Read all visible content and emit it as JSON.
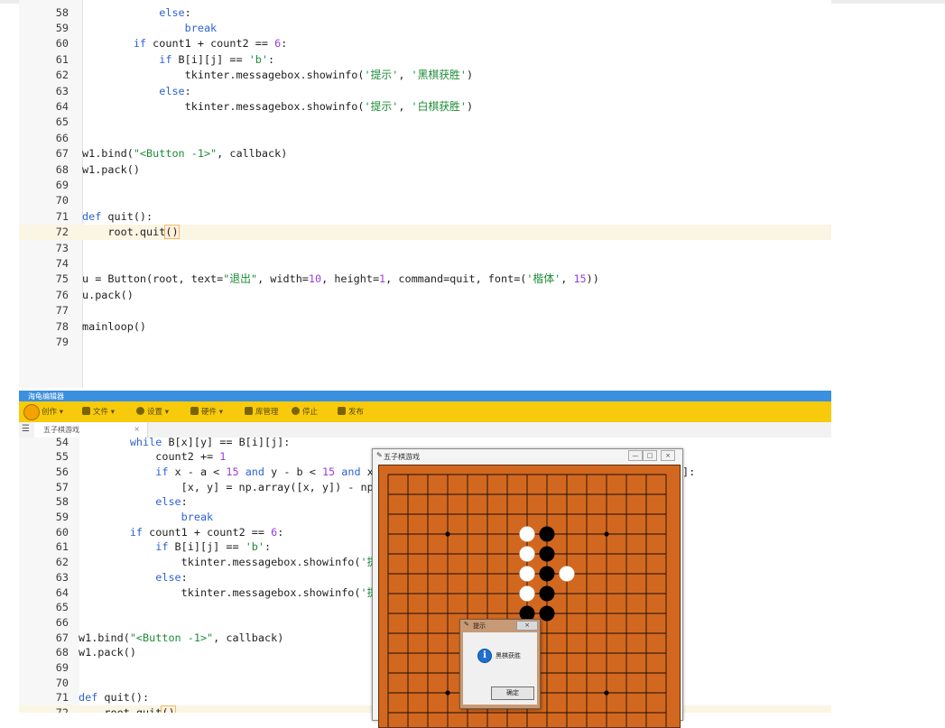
{
  "editor_top": {
    "lines": [
      {
        "n": "58",
        "indent": 6,
        "tokens": [
          {
            "t": "else",
            "c": "kw"
          },
          {
            "t": ":",
            "c": ""
          }
        ]
      },
      {
        "n": "59",
        "indent": 8,
        "tokens": [
          {
            "t": "break",
            "c": "kw"
          }
        ]
      },
      {
        "n": "60",
        "indent": 4,
        "tokens": [
          {
            "t": "if",
            "c": "kw"
          },
          {
            "t": " count1 + count2 == ",
            "c": ""
          },
          {
            "t": "6",
            "c": "num"
          },
          {
            "t": ":",
            "c": ""
          }
        ]
      },
      {
        "n": "61",
        "indent": 6,
        "tokens": [
          {
            "t": "if",
            "c": "kw"
          },
          {
            "t": " B[i][j] == ",
            "c": ""
          },
          {
            "t": "'b'",
            "c": "str"
          },
          {
            "t": ":",
            "c": ""
          }
        ]
      },
      {
        "n": "62",
        "indent": 8,
        "tokens": [
          {
            "t": "tkinter.messagebox.showinfo(",
            "c": ""
          },
          {
            "t": "'提示'",
            "c": "str"
          },
          {
            "t": ", ",
            "c": ""
          },
          {
            "t": "'黑棋获胜'",
            "c": "str"
          },
          {
            "t": ")",
            "c": ""
          }
        ]
      },
      {
        "n": "63",
        "indent": 6,
        "tokens": [
          {
            "t": "else",
            "c": "kw"
          },
          {
            "t": ":",
            "c": ""
          }
        ]
      },
      {
        "n": "64",
        "indent": 8,
        "tokens": [
          {
            "t": "tkinter.messagebox.showinfo(",
            "c": ""
          },
          {
            "t": "'提示'",
            "c": "str"
          },
          {
            "t": ", ",
            "c": ""
          },
          {
            "t": "'白棋获胜'",
            "c": "str"
          },
          {
            "t": ")",
            "c": ""
          }
        ]
      },
      {
        "n": "65",
        "indent": 0,
        "tokens": []
      },
      {
        "n": "66",
        "indent": 0,
        "tokens": []
      },
      {
        "n": "67",
        "indent": 0,
        "tokens": [
          {
            "t": "w1.bind(",
            "c": ""
          },
          {
            "t": "\"<Button -1>\"",
            "c": "str"
          },
          {
            "t": ", callback)",
            "c": ""
          }
        ]
      },
      {
        "n": "68",
        "indent": 0,
        "tokens": [
          {
            "t": "w1.pack()",
            "c": ""
          }
        ]
      },
      {
        "n": "69",
        "indent": 0,
        "tokens": []
      },
      {
        "n": "70",
        "indent": 0,
        "tokens": []
      },
      {
        "n": "71",
        "indent": 0,
        "tokens": [
          {
            "t": "def",
            "c": "kw"
          },
          {
            "t": " quit():",
            "c": ""
          }
        ]
      },
      {
        "n": "72",
        "indent": 2,
        "cur": true,
        "tokens": [
          {
            "t": "root.quit",
            "c": ""
          },
          {
            "t": "()",
            "c": "hl"
          }
        ]
      },
      {
        "n": "73",
        "indent": 0,
        "tokens": []
      },
      {
        "n": "74",
        "indent": 0,
        "tokens": []
      },
      {
        "n": "75",
        "indent": 0,
        "tokens": [
          {
            "t": "u = Button(root, text=",
            "c": ""
          },
          {
            "t": "\"退出\"",
            "c": "str"
          },
          {
            "t": ", width=",
            "c": ""
          },
          {
            "t": "10",
            "c": "num"
          },
          {
            "t": ", height=",
            "c": ""
          },
          {
            "t": "1",
            "c": "num"
          },
          {
            "t": ", command=quit, font=(",
            "c": ""
          },
          {
            "t": "'楷体'",
            "c": "str"
          },
          {
            "t": ", ",
            "c": ""
          },
          {
            "t": "15",
            "c": "num"
          },
          {
            "t": "))",
            "c": ""
          }
        ]
      },
      {
        "n": "76",
        "indent": 0,
        "tokens": [
          {
            "t": "u.pack()",
            "c": ""
          }
        ]
      },
      {
        "n": "77",
        "indent": 0,
        "tokens": []
      },
      {
        "n": "78",
        "indent": 0,
        "tokens": [
          {
            "t": "mainloop()",
            "c": ""
          }
        ]
      },
      {
        "n": "79",
        "indent": 0,
        "tokens": []
      }
    ]
  },
  "ide": {
    "window_title": "海龟编辑器",
    "toolbar": {
      "create": "创作",
      "file": "文件",
      "settings": "设置",
      "hardware": "硬件",
      "library": "库管理",
      "stop": "停止",
      "publish": "发布"
    },
    "tab_label": "五子棋游戏",
    "tab_close": "×"
  },
  "editor_bottom": {
    "lines": [
      {
        "n": "54",
        "indent": 4,
        "tokens": [
          {
            "t": "while",
            "c": "kw"
          },
          {
            "t": " B[x][y] == B[i][j]:",
            "c": ""
          }
        ]
      },
      {
        "n": "55",
        "indent": 6,
        "tokens": [
          {
            "t": "count2 += ",
            "c": ""
          },
          {
            "t": "1",
            "c": "num"
          }
        ]
      },
      {
        "n": "56",
        "indent": 6,
        "tokens": [
          {
            "t": "if",
            "c": "kw"
          },
          {
            "t": " x - a < ",
            "c": ""
          },
          {
            "t": "15",
            "c": "num"
          },
          {
            "t": " ",
            "c": ""
          },
          {
            "t": "and",
            "c": "kw"
          },
          {
            "t": " y - b < ",
            "c": ""
          },
          {
            "t": "15",
            "c": "num"
          },
          {
            "t": " ",
            "c": ""
          },
          {
            "t": "and",
            "c": "kw"
          },
          {
            "t": " x -",
            "c": ""
          }
        ]
      },
      {
        "n": "57",
        "indent": 8,
        "tokens": [
          {
            "t": "[x, y] = np.array([x, y]) - np.ar",
            "c": ""
          }
        ]
      },
      {
        "n": "58",
        "indent": 6,
        "tokens": [
          {
            "t": "else",
            "c": "kw"
          },
          {
            "t": ":",
            "c": ""
          }
        ]
      },
      {
        "n": "59",
        "indent": 8,
        "tokens": [
          {
            "t": "break",
            "c": "kw"
          }
        ]
      },
      {
        "n": "60",
        "indent": 4,
        "tokens": [
          {
            "t": "if",
            "c": "kw"
          },
          {
            "t": " count1 + count2 == ",
            "c": ""
          },
          {
            "t": "6",
            "c": "num"
          },
          {
            "t": ":",
            "c": ""
          }
        ]
      },
      {
        "n": "61",
        "indent": 6,
        "tokens": [
          {
            "t": "if",
            "c": "kw"
          },
          {
            "t": " B[i][j] == ",
            "c": ""
          },
          {
            "t": "'b'",
            "c": "str"
          },
          {
            "t": ":",
            "c": ""
          }
        ]
      },
      {
        "n": "62",
        "indent": 8,
        "tokens": [
          {
            "t": "tkinter.messagebox.showinfo(",
            "c": ""
          },
          {
            "t": "'提示",
            "c": "str"
          }
        ]
      },
      {
        "n": "63",
        "indent": 6,
        "tokens": [
          {
            "t": "else",
            "c": "kw"
          },
          {
            "t": ":",
            "c": ""
          }
        ]
      },
      {
        "n": "64",
        "indent": 8,
        "tokens": [
          {
            "t": "tkinter.messagebox.showinfo(",
            "c": ""
          },
          {
            "t": "'提示",
            "c": "str"
          }
        ]
      },
      {
        "n": "65",
        "indent": 0,
        "tokens": []
      },
      {
        "n": "66",
        "indent": 0,
        "tokens": []
      },
      {
        "n": "67",
        "indent": 0,
        "tokens": [
          {
            "t": "w1.bind(",
            "c": ""
          },
          {
            "t": "\"<Button -1>\"",
            "c": "str"
          },
          {
            "t": ", callback)",
            "c": ""
          }
        ]
      },
      {
        "n": "68",
        "indent": 0,
        "tokens": [
          {
            "t": "w1.pack()",
            "c": ""
          }
        ]
      },
      {
        "n": "69",
        "indent": 0,
        "tokens": []
      },
      {
        "n": "70",
        "indent": 0,
        "tokens": []
      },
      {
        "n": "71",
        "indent": 0,
        "tokens": [
          {
            "t": "def",
            "c": "kw"
          },
          {
            "t": " quit():",
            "c": ""
          }
        ]
      },
      {
        "n": "72",
        "indent": 2,
        "cur": true,
        "tokens": [
          {
            "t": "root.quit",
            "c": ""
          },
          {
            "t": "()",
            "c": "hl"
          }
        ]
      }
    ],
    "right_fragment": "]:"
  },
  "game_window": {
    "title": "五子棋游戏",
    "minimize": "—",
    "maximize": "□",
    "close": "×",
    "board_color": "#d2681f",
    "black_stones": [
      [
        8,
        3
      ],
      [
        8,
        4
      ],
      [
        8,
        5
      ],
      [
        8,
        6
      ],
      [
        7,
        7
      ],
      [
        8,
        7
      ]
    ],
    "white_stones": [
      [
        7,
        3
      ],
      [
        7,
        4
      ],
      [
        7,
        5
      ],
      [
        7,
        6
      ],
      [
        9,
        5
      ]
    ],
    "star_points": [
      [
        3,
        3
      ],
      [
        11,
        3
      ],
      [
        3,
        11
      ],
      [
        11,
        11
      ]
    ]
  },
  "dialog": {
    "title": "提示",
    "message": "黑棋获胜",
    "ok": "确定",
    "close": "×"
  },
  "colors": {
    "toolbar": "#f7cb0c",
    "titlebar": "#3b8fe0",
    "keyword": "#2e63d6",
    "string": "#1b8a36",
    "number": "#9b3ce0"
  }
}
